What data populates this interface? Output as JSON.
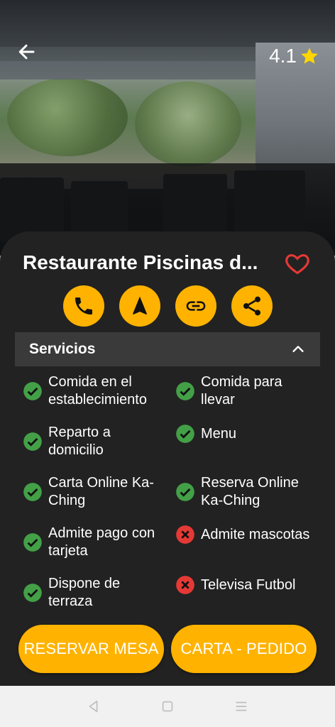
{
  "header": {
    "rating": "4.1"
  },
  "restaurant": {
    "name": "Restaurante Piscinas d..."
  },
  "actions": [
    "phone-icon",
    "navigate-icon",
    "link-icon",
    "share-icon"
  ],
  "section": {
    "title": "Servicios"
  },
  "services": [
    {
      "label": "Comida en el establecimiento",
      "available": true
    },
    {
      "label": "Comida para llevar",
      "available": true
    },
    {
      "label": "Reparto a domicilio",
      "available": true
    },
    {
      "label": "Menu",
      "available": true
    },
    {
      "label": "Carta Online Ka-Ching",
      "available": true
    },
    {
      "label": "Reserva Online Ka-Ching",
      "available": true
    },
    {
      "label": "Admite pago con tarjeta",
      "available": true
    },
    {
      "label": "Admite mascotas",
      "available": false
    },
    {
      "label": "Dispone de terraza",
      "available": true
    },
    {
      "label": "Televisa Futbol",
      "available": false
    }
  ],
  "buttons": {
    "reserve": "RESERVAR MESA",
    "menu": "CARTA - PEDIDO"
  },
  "colors": {
    "accent": "#FFB300",
    "check": "#43A047",
    "cross": "#E53935",
    "sheet": "#222222",
    "heart": "#E53935"
  }
}
